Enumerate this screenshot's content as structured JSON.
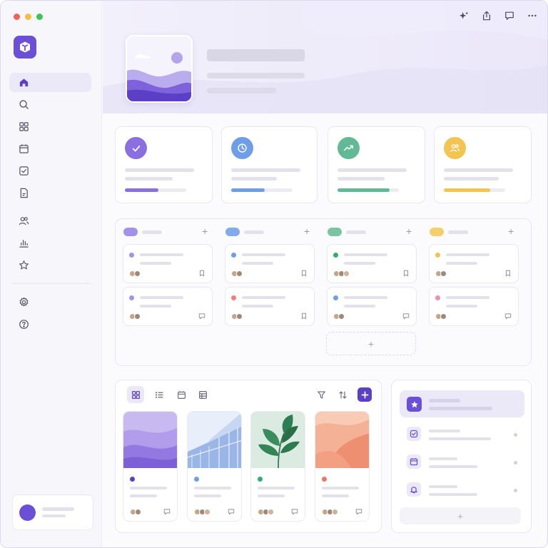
{
  "window": {
    "traffic_lights": {
      "close": "#f26159",
      "minimize": "#f7bd3e",
      "maximize": "#3fc351"
    }
  },
  "brand": {
    "accent": "#6b4fd6",
    "logo_icon": "cube-icon"
  },
  "sidebar": {
    "items": [
      {
        "id": "home",
        "icon": "home-icon",
        "active": true
      },
      {
        "id": "search",
        "icon": "search-icon"
      },
      {
        "id": "apps",
        "icon": "grid-icon"
      },
      {
        "id": "calendar",
        "icon": "calendar-icon"
      },
      {
        "id": "tasks",
        "icon": "checkbox-icon"
      },
      {
        "id": "documents",
        "icon": "document-icon"
      },
      {
        "id": "team",
        "icon": "users-icon"
      },
      {
        "id": "analytics",
        "icon": "bar-chart-icon"
      },
      {
        "id": "favorites",
        "icon": "star-icon"
      },
      {
        "id": "settings",
        "icon": "gear-icon"
      },
      {
        "id": "help",
        "icon": "help-circle-icon"
      }
    ]
  },
  "topbar": {
    "icons": [
      "sparkle-icon",
      "share-icon",
      "comment-icon",
      "more-icon"
    ]
  },
  "stats": [
    {
      "icon": "check-icon",
      "color": "#8b6fe0",
      "progress": 0.55
    },
    {
      "icon": "clock-icon",
      "color": "#6f9ee8",
      "progress": 0.55
    },
    {
      "icon": "trend-up-icon",
      "color": "#62b995",
      "progress": 0.85
    },
    {
      "icon": "users-icon",
      "color": "#f3c44f",
      "progress": 0.75
    }
  ],
  "board": {
    "columns": [
      {
        "color": "#a491ea",
        "cards": [
          {
            "dot": "#a491ea",
            "icon": "bookmark-icon"
          },
          {
            "dot": "#a491ea",
            "icon": "comment-icon"
          }
        ]
      },
      {
        "color": "#83aaeb",
        "cards": [
          {
            "dot": "#6f9ee8",
            "icon": "bookmark-icon"
          },
          {
            "dot": "#ef7f76",
            "icon": "bookmark-icon"
          }
        ]
      },
      {
        "color": "#7cc4a0",
        "cards": [
          {
            "dot": "#2fae6e",
            "icon": "bookmark-icon"
          },
          {
            "dot": "#6f9ee8",
            "icon": "comment-icon"
          }
        ]
      },
      {
        "color": "#f6cf6d",
        "cards": [
          {
            "dot": "#f3c44f",
            "icon": "bookmark-icon"
          },
          {
            "dot": "#ec8fb3",
            "icon": "comment-icon"
          }
        ]
      }
    ],
    "add_label": "+"
  },
  "gallery": {
    "views": [
      "grid-view-icon",
      "list-view-icon",
      "calendar-view-icon",
      "table-view-icon"
    ],
    "tools": [
      "filter-icon",
      "sort-icon",
      "add-icon"
    ],
    "cards": [
      {
        "thumb": "purple-waves",
        "dot": "#5b3fc6"
      },
      {
        "thumb": "glass-building",
        "dot": "#6f9ee8"
      },
      {
        "thumb": "green-plant",
        "dot": "#2fae6e"
      },
      {
        "thumb": "coral-waves",
        "dot": "#e9785f"
      }
    ]
  },
  "rpanel": {
    "items": [
      {
        "icon": "star-icon",
        "active": true
      },
      {
        "icon": "check-square-icon"
      },
      {
        "icon": "calendar-icon"
      },
      {
        "icon": "bell-icon"
      }
    ],
    "add_label": "+"
  }
}
